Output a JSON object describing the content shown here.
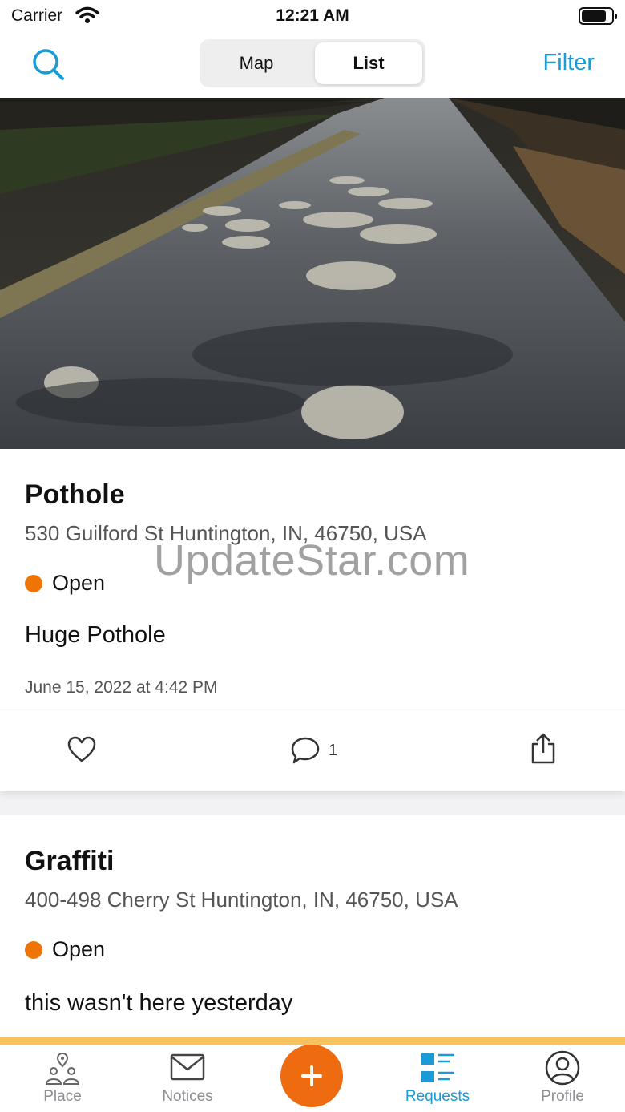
{
  "status_bar": {
    "carrier": "Carrier",
    "time": "12:21 AM"
  },
  "nav": {
    "search_icon": "search-icon",
    "segments": [
      "Map",
      "List"
    ],
    "selected_segment": "List",
    "filter_label": "Filter"
  },
  "requests": [
    {
      "title": "Pothole",
      "address": "530 Guilford St Huntington, IN, 46750, USA",
      "status": "Open",
      "description": "Huge Pothole",
      "date": "June 15, 2022 at 4:42 PM",
      "comment_count": "1"
    },
    {
      "title": "Graffiti",
      "address": "400-498 Cherry St Huntington, IN, 46750, USA",
      "status": "Open",
      "description": "this wasn't here yesterday"
    }
  ],
  "watermark": "UpdateStar.com",
  "tab_bar": {
    "tabs": [
      {
        "label": "Place",
        "icon": "place-icon"
      },
      {
        "label": "Notices",
        "icon": "envelope-icon"
      },
      {
        "label": "Requests",
        "icon": "list-icon"
      },
      {
        "label": "Profile",
        "icon": "person-icon"
      }
    ],
    "active_tab": "Requests",
    "add_icon": "plus-icon"
  },
  "colors": {
    "accent": "#1a9bd6",
    "status_open": "#ee7405",
    "fab": "#ee6b10"
  }
}
